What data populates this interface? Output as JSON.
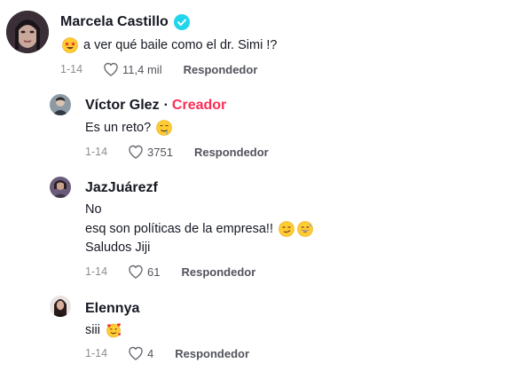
{
  "colors": {
    "creator_accent": "#fe2c55",
    "verified": "#20d5ec"
  },
  "comments": [
    {
      "username": "Marcela Castillo",
      "verified": true,
      "lines": [
        "a ver qué baile como el dr. Simi !?"
      ],
      "emoji_before": "star-struck-emoji",
      "date": "1-14",
      "likes": "11,4 mil",
      "reply_label": "Respondedor"
    },
    {
      "username": "Víctor Glez",
      "creator_separator": "·",
      "creator_label": "Creador",
      "lines": [
        "Es un reto?"
      ],
      "emoji_after": "drooling-face-emoji",
      "date": "1-14",
      "likes": "3751",
      "reply_label": "Respondedor"
    },
    {
      "username": "JazJuárezf",
      "lines": [
        "No",
        "esq son políticas de la empresa!!",
        "Saludos Jiji"
      ],
      "emoji_after_line2": [
        "smirking-face-emoji",
        "grinning-sweat-emoji"
      ],
      "date": "1-14",
      "likes": "61",
      "reply_label": "Respondedor"
    },
    {
      "username": "Elennya",
      "lines": [
        "siii"
      ],
      "emoji_after": "smiling-hearts-emoji",
      "date": "1-14",
      "likes": "4",
      "reply_label": "Respondedor"
    }
  ]
}
